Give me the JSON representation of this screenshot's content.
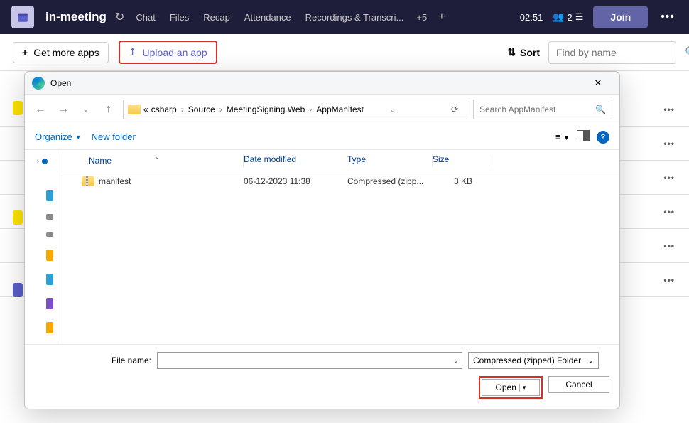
{
  "header": {
    "title": "in-meeting",
    "tabs": [
      "Chat",
      "Files",
      "Recap",
      "Attendance",
      "Recordings & Transcri..."
    ],
    "plus_count": "+5",
    "timer": "02:51",
    "people_count": "2",
    "join": "Join"
  },
  "toolbar": {
    "get_apps": "Get more apps",
    "upload": "Upload an app",
    "sort": "Sort",
    "search_placeholder": "Find by name"
  },
  "dialog": {
    "title": "Open",
    "breadcrumb": [
      "csharp",
      "Source",
      "MeetingSigning.Web",
      "AppManifest"
    ],
    "bc_prefix": "«",
    "search_placeholder": "Search AppManifest",
    "organize": "Organize",
    "new_folder": "New folder",
    "columns": {
      "name": "Name",
      "date": "Date modified",
      "type": "Type",
      "size": "Size"
    },
    "files": [
      {
        "name": "manifest",
        "date": "06-12-2023 11:38",
        "type": "Compressed (zipp...",
        "size": "3 KB"
      }
    ],
    "filename_label": "File name:",
    "filter": "Compressed (zipped) Folder",
    "open": "Open",
    "cancel": "Cancel"
  }
}
